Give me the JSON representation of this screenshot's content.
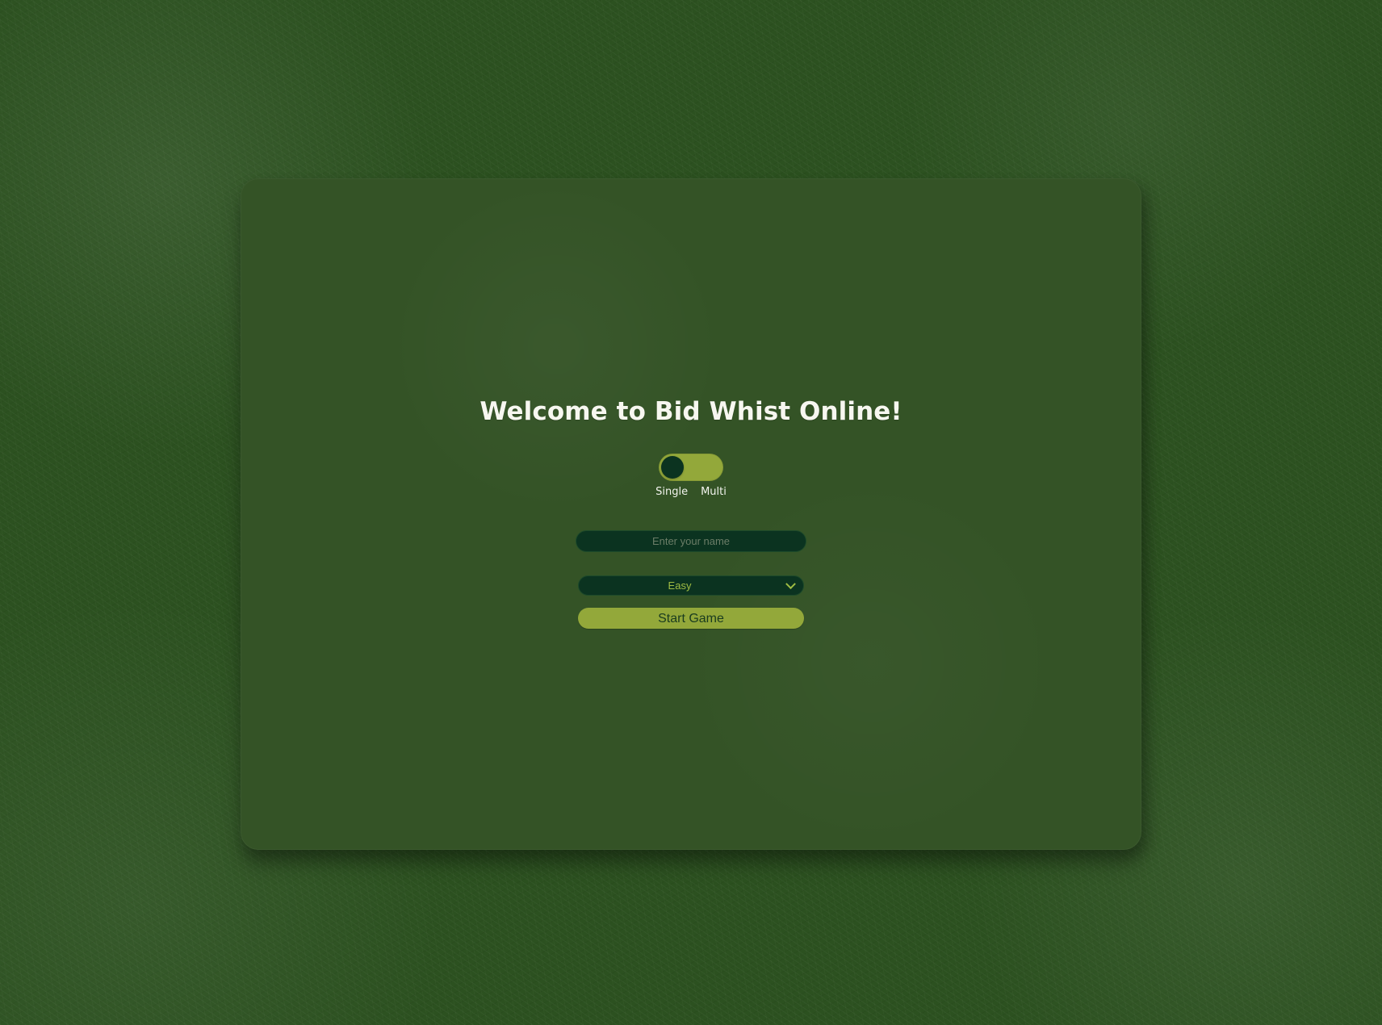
{
  "welcome": {
    "title": "Welcome to Bid Whist Online!"
  },
  "mode": {
    "left_label": "Single",
    "right_label": "Multi",
    "selected": "Single"
  },
  "form": {
    "name_placeholder": "Enter your name",
    "name_value": "",
    "difficulty_selected": "Easy",
    "difficulty_options": [
      "Easy"
    ],
    "start_label": "Start Game"
  },
  "icons": {
    "dropdown": "chevron-down-icon"
  },
  "colors": {
    "background": "#2c5120",
    "panel": "#345326",
    "accent": "#93a83a",
    "dark_control": "#0b3320",
    "title_text": "#f7f7f0"
  }
}
